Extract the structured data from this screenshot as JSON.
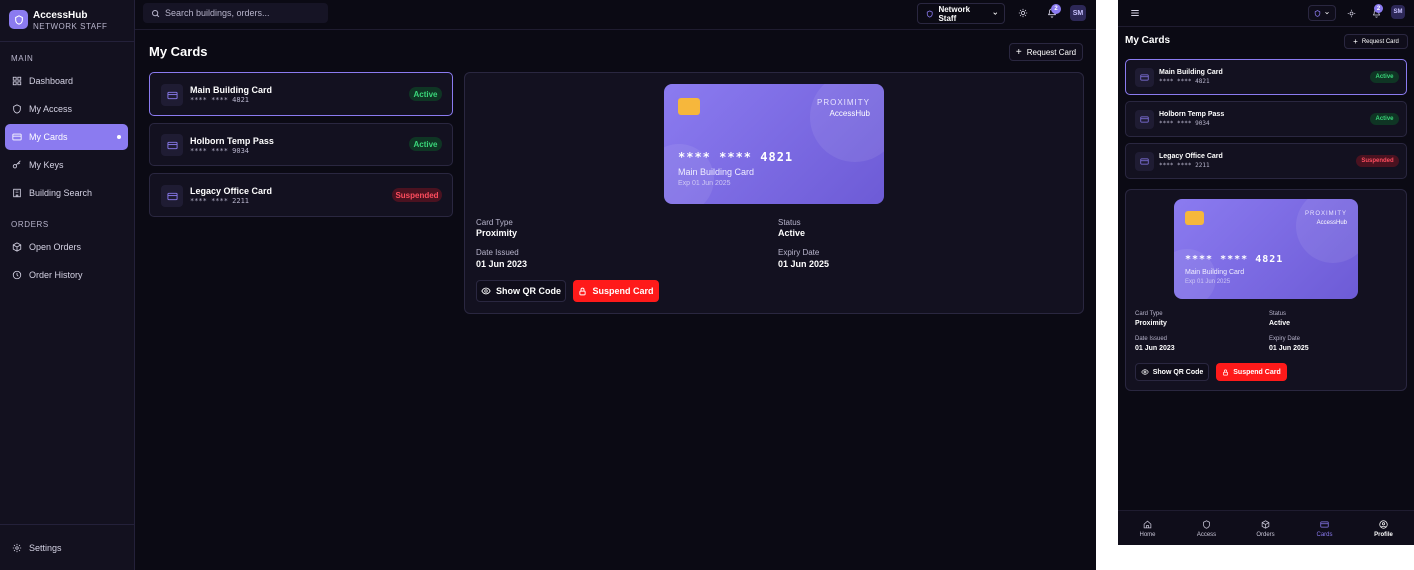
{
  "brand": {
    "name": "AccessHub",
    "subtitle": "NETWORK STAFF"
  },
  "sidebar": {
    "sections": [
      {
        "title": "MAIN"
      },
      {
        "title": "ORDERS"
      }
    ],
    "items": [
      {
        "label": "Dashboard",
        "icon": "grid-icon"
      },
      {
        "label": "My Access",
        "icon": "shield-icon"
      },
      {
        "label": "My Cards",
        "icon": "card-icon"
      },
      {
        "label": "My Keys",
        "icon": "key-icon"
      },
      {
        "label": "Building Search",
        "icon": "building-icon"
      },
      {
        "label": "Open Orders",
        "icon": "box-icon"
      },
      {
        "label": "Order History",
        "icon": "clock-icon"
      }
    ],
    "settings_label": "Settings"
  },
  "topbar": {
    "search_placeholder": "Search buildings, orders...",
    "role": "Network Staff",
    "notification_count": "2",
    "avatar_initials": "SM"
  },
  "page": {
    "title": "My Cards",
    "request_button": "Request Card"
  },
  "cards": [
    {
      "name": "Main Building Card",
      "number": "**** **** 4821",
      "status": "Active"
    },
    {
      "name": "Holborn Temp Pass",
      "number": "**** **** 9034",
      "status": "Active"
    },
    {
      "name": "Legacy Office Card",
      "number": "**** **** 2211",
      "status": "Suspended"
    }
  ],
  "detail": {
    "visual": {
      "type": "PROXIMITY",
      "brand": "AccessHub",
      "number": "**** **** 4821",
      "name": "Main Building Card",
      "expiry": "Exp 01 Jun 2025"
    },
    "fields": {
      "card_type_label": "Card Type",
      "card_type": "Proximity",
      "status_label": "Status",
      "status": "Active",
      "issued_label": "Date Issued",
      "issued": "01 Jun 2023",
      "expiry_label": "Expiry Date",
      "expiry": "01 Jun 2025"
    },
    "qr_button": "Show QR Code",
    "suspend_button": "Suspend Card"
  },
  "mobile_nav": [
    {
      "label": "Home",
      "icon": "home-icon"
    },
    {
      "label": "Access",
      "icon": "shield-icon"
    },
    {
      "label": "Orders",
      "icon": "box-icon"
    },
    {
      "label": "Cards",
      "icon": "card-icon"
    },
    {
      "label": "Profile",
      "icon": "user-icon"
    }
  ],
  "colors": {
    "accent": "#8b7bf0",
    "background": "#0b0a14",
    "active_status": "#3ad67a",
    "suspended_status": "#ff4d5e",
    "danger": "#ff1a1a"
  }
}
